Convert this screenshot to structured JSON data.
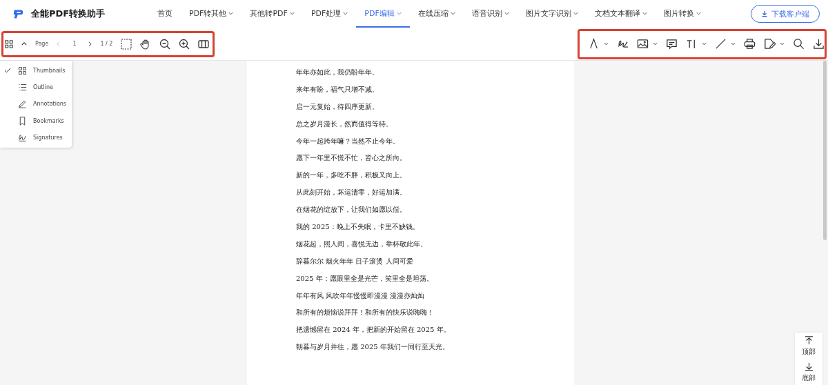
{
  "header": {
    "app_name": "全能PDF转换助手",
    "nav": [
      {
        "label": "首页",
        "dropdown": false,
        "selected": false
      },
      {
        "label": "PDF转其他",
        "dropdown": true,
        "selected": false
      },
      {
        "label": "其他转PDF",
        "dropdown": true,
        "selected": false
      },
      {
        "label": "PDF处理",
        "dropdown": true,
        "selected": false
      },
      {
        "label": "PDF编辑",
        "dropdown": true,
        "selected": true
      },
      {
        "label": "在线压缩",
        "dropdown": true,
        "selected": false
      },
      {
        "label": "语音识别",
        "dropdown": true,
        "selected": false
      },
      {
        "label": "图片文字识别",
        "dropdown": true,
        "selected": false
      },
      {
        "label": "文档文本翻译",
        "dropdown": true,
        "selected": false
      },
      {
        "label": "图片转换",
        "dropdown": true,
        "selected": false
      }
    ],
    "download_button": "下载客户端"
  },
  "viewer_toolbar": {
    "page_label": "Page",
    "page_value": "1",
    "page_count": "1 / 2"
  },
  "edit_tools": [
    {
      "kind": "pen",
      "dropdown": true
    },
    {
      "kind": "signature",
      "dropdown": false
    },
    {
      "kind": "image",
      "dropdown": true
    },
    {
      "kind": "comment",
      "dropdown": false
    },
    {
      "kind": "text",
      "dropdown": true
    },
    {
      "kind": "line",
      "dropdown": true
    },
    {
      "kind": "print",
      "dropdown": false
    },
    {
      "kind": "edit",
      "dropdown": true
    },
    {
      "kind": "search",
      "dropdown": false
    },
    {
      "kind": "download",
      "dropdown": false
    }
  ],
  "panel_menu": [
    {
      "label": "Thumbnails",
      "kind": "thumbnails",
      "selected": true
    },
    {
      "label": "Outline",
      "kind": "outline",
      "selected": false
    },
    {
      "label": "Annotations",
      "kind": "annotations",
      "selected": false
    },
    {
      "label": "Bookmarks",
      "kind": "bookmarks",
      "selected": false
    },
    {
      "label": "Signatures",
      "kind": "signatures",
      "selected": false
    }
  ],
  "document_lines": [
    "年年亦如此，我仍盼年年。",
    "来年有盼，福气只增不减。",
    "启一元复始，待四序更新。",
    "总之岁月漫长，然而值得等待。",
    "今年一起跨年嘛？当然不止今年。",
    "愿下一年里不慌不忙，皆心之所向。",
    "新的一年，多吃不胖，积极又向上。",
    "从此刻开始，坏运清零，好运加满。",
    "在烟花的绽放下，让我们如愿以偿。",
    "我的 2025：晚上不失眠，卡里不缺钱。",
    "烟花起，照人间，喜悦无边，举杯敬此年。",
    "辞暮尔尔  烟火年年  日子滚烫  人间可爱",
    "2025 年：愿眼里全是光芒，笑里全是坦荡。",
    "年年有风  风吹年年慢慢即漫漫  漫漫亦灿灿",
    "和所有的烦恼说拜拜！和所有的快乐说嗨嗨！",
    "把遗憾留在 2024 年，把新的开始留在 2025 年。",
    "朝暮与岁月并往，愿 2025 年我们一同行至天光。"
  ],
  "scroll_buttons": [
    "顶部",
    "底部"
  ]
}
